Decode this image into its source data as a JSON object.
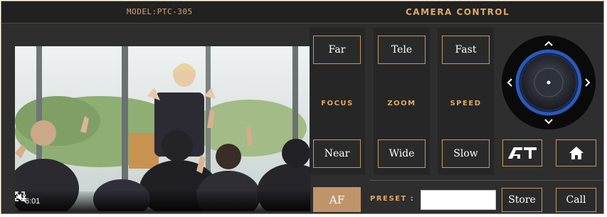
{
  "header": {
    "model": "MODEL:PTC-305",
    "title": "CAMERA CONTROL"
  },
  "video": {
    "time": "6:01",
    "mute_icon": "volume-muted-icon",
    "fullscreen_icon": "fullscreen-icon"
  },
  "focus": {
    "far": "Far",
    "label": "FOCUS",
    "near": "Near"
  },
  "zoom": {
    "tele": "Tele",
    "label": "ZOOM",
    "wide": "Wide"
  },
  "speed": {
    "fast": "Fast",
    "label": "SPEED",
    "slow": "Slow"
  },
  "af": "AF",
  "preset": {
    "label": "PRESET :",
    "value": "",
    "store": "Store",
    "call": "Call"
  },
  "joystick": {
    "icons": [
      "arrow-up-icon",
      "arrow-down-icon",
      "arrow-left-icon",
      "arrow-right-icon"
    ]
  },
  "at_button": {
    "label": "AT"
  },
  "home_button": {
    "icon": "home-icon"
  },
  "colors": {
    "accent": "#e0a867",
    "border": "#c39a62",
    "af_bg": "#c0946a",
    "joystick_ring": "#2a5ab8"
  }
}
